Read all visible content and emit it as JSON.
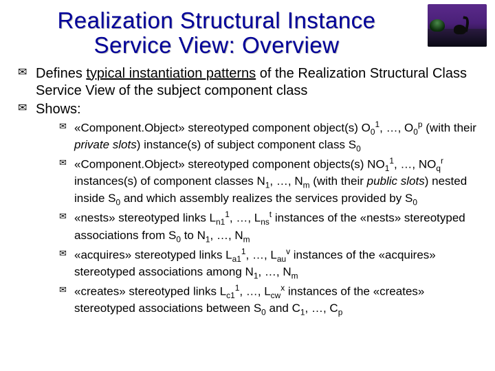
{
  "title": "Realization Structural Instance Service View: Overview",
  "bullets": {
    "b1_pre": "Defines ",
    "b1_u": "typical instantiation patterns",
    "b1_post": " of the Realization Structural Class Service View of the subject component class",
    "b2": "Shows:",
    "s1": {
      "a": "«Component.Object» stereotyped component object(s) O",
      "a_sub1": "0",
      "a_sup1": "1",
      "b": ", …, O",
      "b_sub2": "0",
      "b_sup2": "p",
      "c_pre": " (with their ",
      "c_i": "private slots",
      "c_post": ") instance(s) of subject component class S",
      "c_sub3": "0"
    },
    "s2": {
      "a": "«Component.Object» stereotyped component objects(s) NO",
      "a_sub1": "1",
      "a_sup1": "1",
      "b": ", …, NO",
      "b_sub2": "q",
      "b_sup2": "r",
      "c": " instances(s) of component classes N",
      "c_sub3": "1",
      "d": ", …, N",
      "d_sub4": "m",
      "e_pre": " (with their ",
      "e_i": "public slots",
      "e_post": ") nested inside S",
      "e_sub5": "0",
      "f": " and which assembly realizes the services provided by S",
      "f_sub6": "0"
    },
    "s3": {
      "a": "«nests» stereotyped links L",
      "a_sub1": "n1",
      "a_sup1": "1",
      "b": ", …, L",
      "b_sub2": "ns",
      "b_sup2": "t",
      "c": " instances of the «nests» stereotyped associations from S",
      "c_sub3": "0",
      "d": " to N",
      "d_sub4": "1",
      "e": ", …, N",
      "e_sub5": "m"
    },
    "s4": {
      "a": "«acquires» stereotyped links L",
      "a_sub1": "a1",
      "a_sup1": "1",
      "b": ", …, L",
      "b_sub2": "au",
      "b_sup2": "v",
      "c": " instances of the «acquires» stereotyped associations among N",
      "c_sub3": "1",
      "d": ", …, N",
      "d_sub4": "m"
    },
    "s5": {
      "a": "«creates» stereotyped links L",
      "a_sub1": "c1",
      "a_sup1": "1",
      "b": ", …, L",
      "b_sub2": "cw",
      "b_sup2": "x",
      "c": " instances of the «creates» stereotyped associations between S",
      "c_sub3": "0",
      "d": " and C",
      "d_sub4": "1",
      "e": ", …, C",
      "e_sub5": "p"
    }
  }
}
